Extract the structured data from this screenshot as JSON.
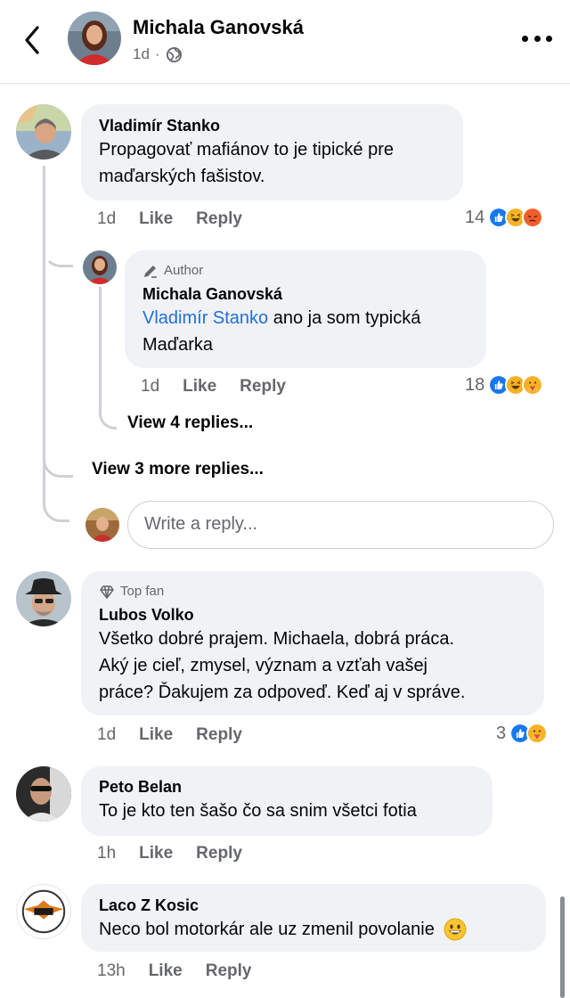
{
  "header": {
    "title": "Michala Ganovská",
    "time": "1d",
    "separator": "·",
    "privacy_icon": "globe-icon"
  },
  "comments": [
    {
      "author": "Vladimír Stanko",
      "lines": [
        "Propagovať mafiánov to je tipické pre",
        "maďarských fašistov."
      ],
      "time": "1d",
      "like": "Like",
      "reply": "Reply",
      "reaction_count": "14",
      "reactions": [
        "like",
        "haha",
        "angry"
      ]
    },
    {
      "badge": "Author",
      "author": "Michala Ganovská",
      "mention": "Vladimír Stanko",
      "line1_rest": " ano ja som typická",
      "line2": "Maďarka",
      "time": "1d",
      "like": "Like",
      "reply": "Reply",
      "reaction_count": "18",
      "reactions": [
        "like",
        "haha",
        "care"
      ]
    },
    {
      "badge": "Top fan",
      "author": "Lubos Volko",
      "lines": [
        "Všetko dobré prajem. Michaela,  dobrá práca.",
        "Aký je cieľ, zmysel, význam a vzťah vašej",
        "práce? Ďakujem za odpoveď. Keď aj v správe."
      ],
      "time": "1d",
      "like": "Like",
      "reply": "Reply",
      "reaction_count": "3",
      "reactions": [
        "like",
        "care"
      ]
    },
    {
      "author": "Peto Belan",
      "lines": [
        "To je kto ten šašo čo sa snim všetci fotia"
      ],
      "time": "1h",
      "like": "Like",
      "reply": "Reply"
    },
    {
      "author": "Laco Z Kosic",
      "text": "Neco bol motorkár ale uz zmenil povolanie",
      "emoji": "grinning-face",
      "time": "13h",
      "like": "Like",
      "reply": "Reply"
    }
  ],
  "thread": {
    "view_nested": "View 4 replies...",
    "view_more": "View 3 more replies...",
    "reply_placeholder": "Write a reply..."
  },
  "colors": {
    "bubble": "#f0f2f5",
    "secondary_text": "#65676b",
    "mention": "#216fdb",
    "like_blue": "#1877f2",
    "haha_yellow": "#f7b125",
    "angry_red": "#e9710f"
  }
}
